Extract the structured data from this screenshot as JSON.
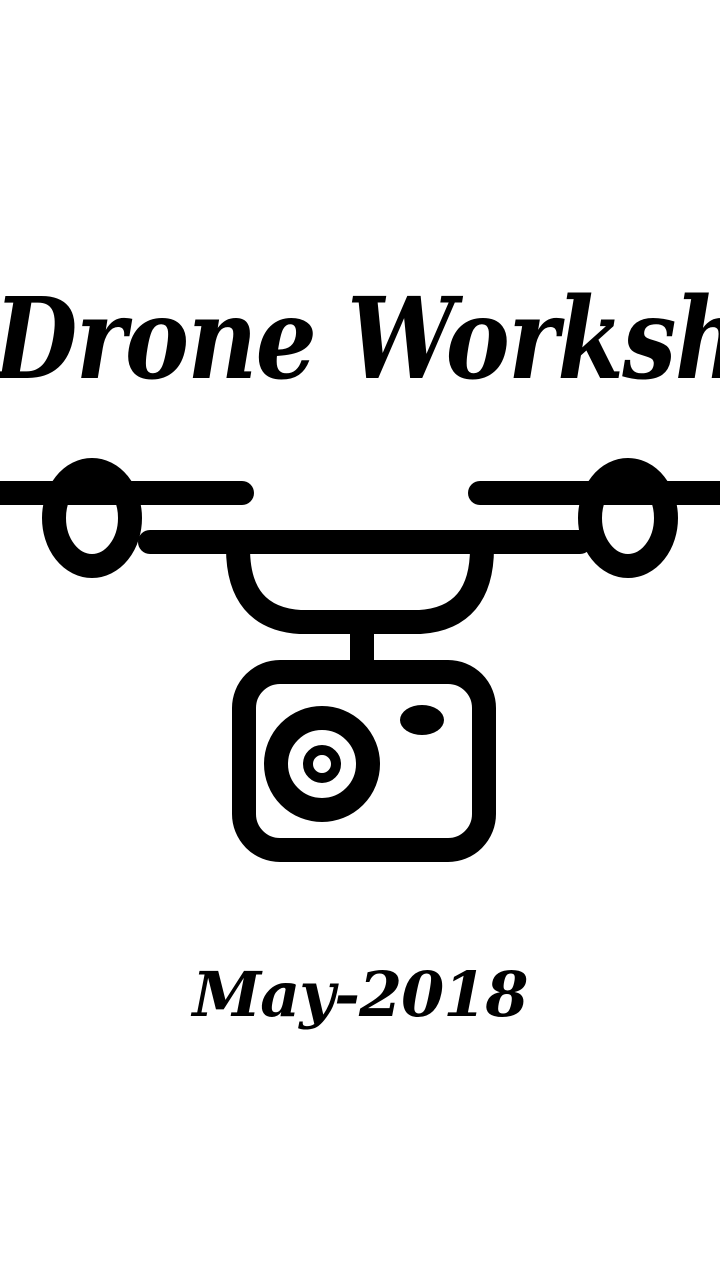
{
  "poster": {
    "title": "Drone Workshop",
    "date": "May-2018"
  },
  "illustration": {
    "icon": "drone-camera-icon",
    "color": "#000000"
  },
  "theme": {
    "background": "#ffffff",
    "foreground": "#000000"
  }
}
